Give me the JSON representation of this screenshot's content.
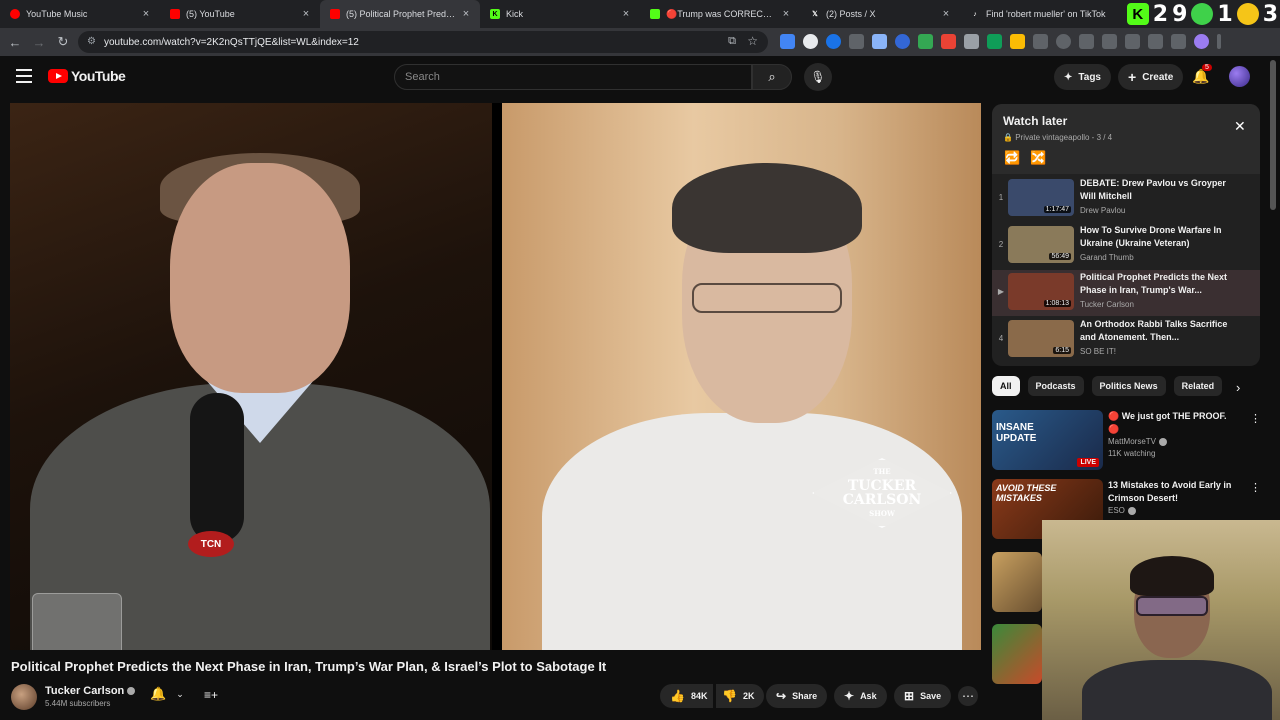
{
  "browser": {
    "tabs": [
      {
        "label": "YouTube Music",
        "color": "#ff0000"
      },
      {
        "label": "(5) YouTube",
        "color": "#ff0000"
      },
      {
        "label": "(5) Political Prophet Predicts the",
        "color": "#ff0000"
      },
      {
        "label": "Kick",
        "color": "#53fc18"
      },
      {
        "label": "🔴Trump was CORRECT... the E",
        "color": "#53fc18"
      },
      {
        "label": "(2) Posts / X",
        "color": "#1d9bf0"
      },
      {
        "label": "Find 'robert mueller' on TikTok",
        "color": "#ffffff"
      }
    ],
    "overlay": {
      "k": "K",
      "d1": "2",
      "d2": "9",
      "d3": "1",
      "d4": "3"
    },
    "url": "youtube.com/watch?v=2K2nQsTTjQE&list=WL&index=12"
  },
  "header": {
    "logo_text": "YouTube",
    "search_placeholder": "Search",
    "tags_label": "Tags",
    "create_label": "Create",
    "notif_count": "5"
  },
  "video": {
    "watermark_line1": "THE",
    "watermark_line2": "TUCKER",
    "watermark_line3": "CARLSON",
    "watermark_line4": "SHOW",
    "mic_badge": "TCN",
    "title": "Political Prophet Predicts the Next Phase in Iran, Trump’s War Plan, & Israel’s Plot to Sabotage It",
    "channel": "Tucker Carlson",
    "subscribers": "5.44M subscribers",
    "likes": "84K",
    "dislikes": "2K",
    "share_label": "Share",
    "ask_label": "Ask",
    "save_label": "Save"
  },
  "watch_later": {
    "title": "Watch later",
    "subtitle": "Private vintageapollo - 3 / 4",
    "items": [
      {
        "index": "1",
        "title": "DEBATE: Drew Pavlou vs Groyper Will Mitchell",
        "channel": "Drew Pavlou",
        "duration": "1:17:47",
        "thumb_color": "#3a4a6b"
      },
      {
        "index": "2",
        "title": "How To Survive Drone Warfare In Ukraine (Ukraine Veteran)",
        "channel": "Garand Thumb",
        "duration": "56:49",
        "thumb_color": "#8a7a5a"
      },
      {
        "index": "▶",
        "title": "Political Prophet Predicts the Next Phase in Iran, Trump's War...",
        "channel": "Tucker Carlson",
        "duration": "1:08:13",
        "thumb_color": "#7a3a2a"
      },
      {
        "index": "4",
        "title": "An Orthodox Rabbi Talks Sacrifice and Atonement. Then...",
        "channel": "SO BE IT!",
        "duration": "6:15",
        "thumb_color": "#8a6a4a"
      }
    ]
  },
  "chips": [
    "All",
    "Podcasts",
    "Politics News",
    "Related"
  ],
  "recommendations": [
    {
      "title": "🔴 We just got THE PROOF. 🔴",
      "channel": "MattMorseTV",
      "meta": "11K watching",
      "live": "LIVE",
      "thumb_text": "INSANE UPDATE",
      "thumb_color": "#2a5a8a"
    },
    {
      "title": "13 Mistakes to Avoid Early in Crimson Desert!",
      "channel": "ESO",
      "meta": "",
      "live": "",
      "thumb_text": "AVOID THESE MISTAKES",
      "thumb_color": "#8a3a1a"
    }
  ]
}
